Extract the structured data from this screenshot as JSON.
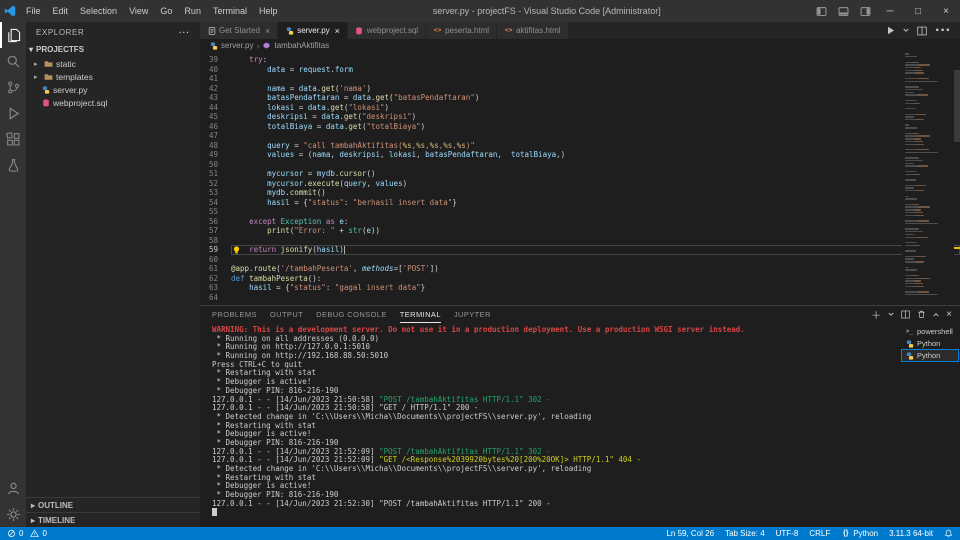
{
  "title_bar": {
    "title": "server.py - projectFS - Visual Studio Code [Administrator]",
    "menus": [
      "File",
      "Edit",
      "Selection",
      "View",
      "Go",
      "Run",
      "Terminal",
      "Help"
    ]
  },
  "explorer": {
    "header": "EXPLORER",
    "root": "PROJECTFS",
    "items": [
      {
        "label": "static",
        "type": "folder"
      },
      {
        "label": "templates",
        "type": "folder"
      },
      {
        "label": "server.py",
        "type": "file",
        "icon": "python"
      },
      {
        "label": "webproject.sql",
        "type": "file",
        "icon": "sql"
      }
    ],
    "outline_label": "OUTLINE",
    "timeline_label": "TIMELINE"
  },
  "tabs": [
    {
      "label": "Get Started",
      "icon": "welcome",
      "active": false,
      "close": true
    },
    {
      "label": "server.py",
      "icon": "python",
      "active": true,
      "close": true
    },
    {
      "label": "webproject.sql",
      "icon": "sql",
      "active": false,
      "close": false
    },
    {
      "label": "peserta.html",
      "icon": "html",
      "active": false,
      "close": false
    },
    {
      "label": "aktifitas.html",
      "icon": "html",
      "active": false,
      "close": false
    }
  ],
  "breadcrumb": {
    "items": [
      {
        "label": "server.py",
        "icon": "python"
      },
      {
        "label": "tambahAktifitas",
        "icon": "method"
      }
    ]
  },
  "editor": {
    "lines": [
      {
        "n": 39,
        "tokens": [
          {
            "t": "    "
          },
          {
            "t": "try",
            "c": "kw"
          },
          {
            "t": ":",
            "c": "txt"
          }
        ]
      },
      {
        "n": 40,
        "tokens": [
          {
            "t": "        "
          },
          {
            "t": "data",
            "c": "var"
          },
          {
            "t": " = ",
            "c": "txt"
          },
          {
            "t": "request",
            "c": "var"
          },
          {
            "t": ".",
            "c": "txt"
          },
          {
            "t": "form",
            "c": "var"
          }
        ]
      },
      {
        "n": 41,
        "tokens": []
      },
      {
        "n": 42,
        "tokens": [
          {
            "t": "        "
          },
          {
            "t": "nama",
            "c": "var"
          },
          {
            "t": " = ",
            "c": "txt"
          },
          {
            "t": "data",
            "c": "var"
          },
          {
            "t": ".",
            "c": "txt"
          },
          {
            "t": "get",
            "c": "fn"
          },
          {
            "t": "(",
            "c": "txt"
          },
          {
            "t": "'nama'",
            "c": "str"
          },
          {
            "t": ")",
            "c": "txt"
          }
        ]
      },
      {
        "n": 43,
        "tokens": [
          {
            "t": "        "
          },
          {
            "t": "batasPendaftaran",
            "c": "var"
          },
          {
            "t": " = ",
            "c": "txt"
          },
          {
            "t": "data",
            "c": "var"
          },
          {
            "t": ".",
            "c": "txt"
          },
          {
            "t": "get",
            "c": "fn"
          },
          {
            "t": "(",
            "c": "txt"
          },
          {
            "t": "\"batasPendaftaran\"",
            "c": "str"
          },
          {
            "t": ")",
            "c": "txt"
          }
        ]
      },
      {
        "n": 44,
        "tokens": [
          {
            "t": "        "
          },
          {
            "t": "lokasi",
            "c": "var"
          },
          {
            "t": " = ",
            "c": "txt"
          },
          {
            "t": "data",
            "c": "var"
          },
          {
            "t": ".",
            "c": "txt"
          },
          {
            "t": "get",
            "c": "fn"
          },
          {
            "t": "(",
            "c": "txt"
          },
          {
            "t": "\"lokasi\"",
            "c": "str"
          },
          {
            "t": ")",
            "c": "txt"
          }
        ]
      },
      {
        "n": 45,
        "tokens": [
          {
            "t": "        "
          },
          {
            "t": "deskripsi",
            "c": "var"
          },
          {
            "t": " = ",
            "c": "txt"
          },
          {
            "t": "data",
            "c": "var"
          },
          {
            "t": ".",
            "c": "txt"
          },
          {
            "t": "get",
            "c": "fn"
          },
          {
            "t": "(",
            "c": "txt"
          },
          {
            "t": "\"deskripsi\"",
            "c": "str"
          },
          {
            "t": ")",
            "c": "txt"
          }
        ]
      },
      {
        "n": 46,
        "tokens": [
          {
            "t": "        "
          },
          {
            "t": "totalBiaya",
            "c": "var"
          },
          {
            "t": " = ",
            "c": "txt"
          },
          {
            "t": "data",
            "c": "var"
          },
          {
            "t": ".",
            "c": "txt"
          },
          {
            "t": "get",
            "c": "fn"
          },
          {
            "t": "(",
            "c": "txt"
          },
          {
            "t": "\"totalBiaya\"",
            "c": "str"
          },
          {
            "t": ")",
            "c": "txt"
          }
        ]
      },
      {
        "n": 47,
        "tokens": []
      },
      {
        "n": 48,
        "tokens": [
          {
            "t": "        "
          },
          {
            "t": "query",
            "c": "var"
          },
          {
            "t": " = ",
            "c": "txt"
          },
          {
            "t": "\"call tambahAktifitas(",
            "c": "str"
          },
          {
            "t": "%s",
            "c": "fmt"
          },
          {
            "t": ",",
            "c": "str"
          },
          {
            "t": "%s",
            "c": "fmt"
          },
          {
            "t": ",",
            "c": "str"
          },
          {
            "t": "%s",
            "c": "fmt"
          },
          {
            "t": ",",
            "c": "str"
          },
          {
            "t": "%s",
            "c": "fmt"
          },
          {
            "t": ",",
            "c": "str"
          },
          {
            "t": "%s",
            "c": "fmt"
          },
          {
            "t": ")\"",
            "c": "str"
          }
        ]
      },
      {
        "n": 49,
        "tokens": [
          {
            "t": "        "
          },
          {
            "t": "values",
            "c": "var"
          },
          {
            "t": " = (",
            "c": "txt"
          },
          {
            "t": "nama",
            "c": "var"
          },
          {
            "t": ", ",
            "c": "txt"
          },
          {
            "t": "deskripsi",
            "c": "var"
          },
          {
            "t": ", ",
            "c": "txt"
          },
          {
            "t": "lokasi",
            "c": "var"
          },
          {
            "t": ", ",
            "c": "txt"
          },
          {
            "t": "batasPendaftaran",
            "c": "var"
          },
          {
            "t": ",  ",
            "c": "txt"
          },
          {
            "t": "totalBiaya",
            "c": "var"
          },
          {
            "t": ",)",
            "c": "txt"
          }
        ]
      },
      {
        "n": 50,
        "tokens": []
      },
      {
        "n": 51,
        "tokens": [
          {
            "t": "        "
          },
          {
            "t": "mycursor",
            "c": "var"
          },
          {
            "t": " = ",
            "c": "txt"
          },
          {
            "t": "mydb",
            "c": "var"
          },
          {
            "t": ".",
            "c": "txt"
          },
          {
            "t": "cursor",
            "c": "fn"
          },
          {
            "t": "()",
            "c": "txt"
          }
        ]
      },
      {
        "n": 52,
        "tokens": [
          {
            "t": "        "
          },
          {
            "t": "mycursor",
            "c": "var"
          },
          {
            "t": ".",
            "c": "txt"
          },
          {
            "t": "execute",
            "c": "fn"
          },
          {
            "t": "(",
            "c": "txt"
          },
          {
            "t": "query",
            "c": "var"
          },
          {
            "t": ", ",
            "c": "txt"
          },
          {
            "t": "values",
            "c": "var"
          },
          {
            "t": ")",
            "c": "txt"
          }
        ]
      },
      {
        "n": 53,
        "tokens": [
          {
            "t": "        "
          },
          {
            "t": "mydb",
            "c": "var"
          },
          {
            "t": ".",
            "c": "txt"
          },
          {
            "t": "commit",
            "c": "fn"
          },
          {
            "t": "()",
            "c": "txt"
          }
        ]
      },
      {
        "n": 54,
        "tokens": [
          {
            "t": "        "
          },
          {
            "t": "hasil",
            "c": "var"
          },
          {
            "t": " = {",
            "c": "txt"
          },
          {
            "t": "\"status\"",
            "c": "str"
          },
          {
            "t": ": ",
            "c": "txt"
          },
          {
            "t": "\"berhasil insert data\"",
            "c": "str"
          },
          {
            "t": "}",
            "c": "txt"
          }
        ]
      },
      {
        "n": 55,
        "tokens": []
      },
      {
        "n": 56,
        "tokens": [
          {
            "t": "    "
          },
          {
            "t": "except",
            "c": "kw"
          },
          {
            "t": " ",
            "c": "txt"
          },
          {
            "t": "Exception",
            "c": "cls"
          },
          {
            "t": " ",
            "c": "txt"
          },
          {
            "t": "as",
            "c": "kw"
          },
          {
            "t": " ",
            "c": "txt"
          },
          {
            "t": "e",
            "c": "var"
          },
          {
            "t": ":",
            "c": "txt"
          }
        ]
      },
      {
        "n": 57,
        "tokens": [
          {
            "t": "        "
          },
          {
            "t": "print",
            "c": "fn"
          },
          {
            "t": "(",
            "c": "txt"
          },
          {
            "t": "\"Error: \"",
            "c": "str"
          },
          {
            "t": " + ",
            "c": "txt"
          },
          {
            "t": "str",
            "c": "cls"
          },
          {
            "t": "(",
            "c": "txt"
          },
          {
            "t": "e",
            "c": "var"
          },
          {
            "t": "))",
            "c": "txt"
          }
        ]
      },
      {
        "n": 58,
        "tokens": []
      },
      {
        "n": 59,
        "current": true,
        "bulb": true,
        "cursor": true,
        "tokens": [
          {
            "t": "    "
          },
          {
            "t": "return",
            "c": "kw"
          },
          {
            "t": " ",
            "c": "txt"
          },
          {
            "t": "jsonify",
            "c": "fn"
          },
          {
            "t": "(",
            "c": "txt"
          },
          {
            "t": "hasil",
            "c": "var"
          },
          {
            "t": ")",
            "c": "txt"
          }
        ]
      },
      {
        "n": 60,
        "tokens": []
      },
      {
        "n": 61,
        "tokens": [
          {
            "t": "@app.route",
            "c": "fn"
          },
          {
            "t": "(",
            "c": "txt"
          },
          {
            "t": "'/tambahPeserta'",
            "c": "str"
          },
          {
            "t": ", ",
            "c": "txt"
          },
          {
            "t": "methods",
            "c": "param"
          },
          {
            "t": "=[",
            "c": "txt"
          },
          {
            "t": "'POST'",
            "c": "str"
          },
          {
            "t": "])",
            "c": "txt"
          }
        ]
      },
      {
        "n": 62,
        "tokens": [
          {
            "t": "def",
            "c": "def"
          },
          {
            "t": " ",
            "c": "txt"
          },
          {
            "t": "tambahPeserta",
            "c": "fn"
          },
          {
            "t": "():",
            "c": "txt"
          }
        ]
      },
      {
        "n": 63,
        "tokens": [
          {
            "t": "    "
          },
          {
            "t": "hasil",
            "c": "var"
          },
          {
            "t": " = {",
            "c": "txt"
          },
          {
            "t": "\"status\"",
            "c": "str"
          },
          {
            "t": ": ",
            "c": "txt"
          },
          {
            "t": "\"gagal insert data\"",
            "c": "str"
          },
          {
            "t": "}",
            "c": "txt"
          }
        ]
      },
      {
        "n": 64,
        "tokens": []
      }
    ]
  },
  "panel": {
    "tabs": [
      {
        "label": "PROBLEMS",
        "active": false
      },
      {
        "label": "OUTPUT",
        "active": false
      },
      {
        "label": "DEBUG CONSOLE",
        "active": false
      },
      {
        "label": "TERMINAL",
        "active": true
      },
      {
        "label": "JUPYTER",
        "active": false
      }
    ],
    "terminal_lines": [
      [
        {
          "t": "WARNING: This is a development server. Do not use it in a production deployment. Use a production WSGI server instead.",
          "c": "red"
        }
      ],
      [
        {
          "t": " * Running on all addresses (0.0.0.0)"
        }
      ],
      [
        {
          "t": " * Running on http://127.0.0.1:5010"
        }
      ],
      [
        {
          "t": " * Running on http://192.168.88.50:5010"
        }
      ],
      [
        {
          "t": "Press CTRL+C to quit"
        }
      ],
      [
        {
          "t": " * Restarting with stat"
        }
      ],
      [
        {
          "t": " * Debugger is active!"
        }
      ],
      [
        {
          "t": " * Debugger PIN: 816-216-190"
        }
      ],
      [
        {
          "t": "127.0.0.1 - - [14/Jun/2023 21:50:58] "
        },
        {
          "t": "\"POST /tambahAktifitas HTTP/1.1\" 302 -",
          "c": "green"
        }
      ],
      [
        {
          "t": "127.0.0.1 - - [14/Jun/2023 21:50:58] "
        },
        {
          "t": "\"GET / HTTP/1.1\" 200 -"
        }
      ],
      [
        {
          "t": " * Detected change in 'C:\\\\Users\\\\Micha\\\\Documents\\\\projectFS\\\\server.py', reloading"
        }
      ],
      [
        {
          "t": " * Restarting with stat"
        }
      ],
      [
        {
          "t": " * Debugger is active!"
        }
      ],
      [
        {
          "t": " * Debugger PIN: 816-216-190"
        }
      ],
      [
        {
          "t": "127.0.0.1 - - [14/Jun/2023 21:52:09] "
        },
        {
          "t": "\"POST /tambahAktifitas HTTP/1.1\" 302 -",
          "c": "green"
        }
      ],
      [
        {
          "t": "127.0.0.1 - - [14/Jun/2023 21:52:09] "
        },
        {
          "t": "\"GET /<Response%2039920bytes%20[200%20OK]> HTTP/1.1\" 404 -",
          "c": "yellow"
        }
      ],
      [
        {
          "t": " * Detected change in 'C:\\\\Users\\\\Micha\\\\Documents\\\\projectFS\\\\server.py', reloading"
        }
      ],
      [
        {
          "t": " * Restarting with stat"
        }
      ],
      [
        {
          "t": " * Debugger is active!"
        }
      ],
      [
        {
          "t": " * Debugger PIN: 816-216-190"
        }
      ],
      [
        {
          "t": "127.0.0.1 - - [14/Jun/2023 21:52:30] \"POST /tambahAktifitas HTTP/1.1\" 200 -"
        }
      ],
      [
        {
          "t": "",
          "cursor": true
        }
      ]
    ],
    "side_list": [
      {
        "label": "powershell",
        "icon": "terminal",
        "selected": false
      },
      {
        "label": "Python",
        "icon": "python",
        "selected": false
      },
      {
        "label": "Python",
        "icon": "python",
        "selected": true
      }
    ]
  },
  "status_bar": {
    "left": [
      {
        "icon": "error",
        "label": "0"
      },
      {
        "icon": "warning",
        "label": "0"
      }
    ],
    "right": [
      {
        "label": "Ln 59, Col 26"
      },
      {
        "label": "Tab Size: 4"
      },
      {
        "label": "UTF-8"
      },
      {
        "label": "CRLF"
      },
      {
        "label": "Python",
        "icon": "braces"
      },
      {
        "label": "3.11.3 64-bit"
      }
    ]
  }
}
